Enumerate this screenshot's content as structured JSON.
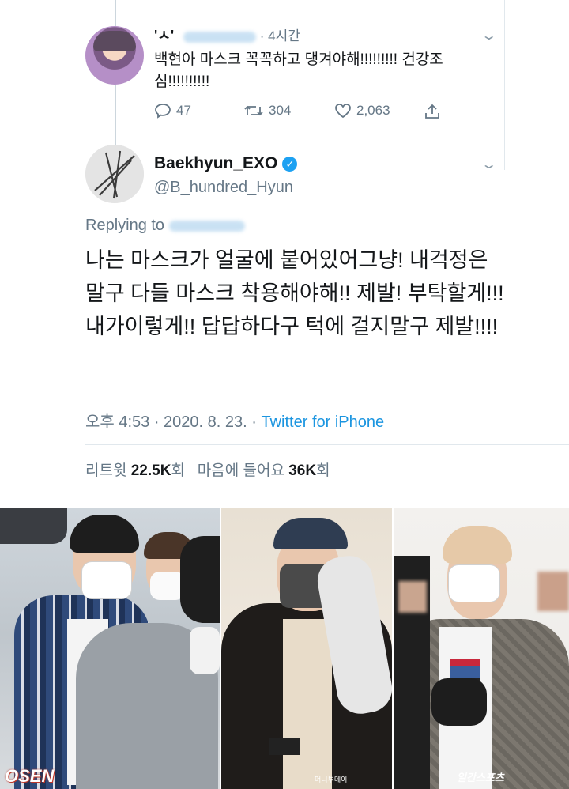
{
  "reply_tweet": {
    "name": "'ㅅ'",
    "meta": "· 4시간",
    "text": "백현아 마스크 꼭꼭하고 댕겨야해!!!!!!!!! 건강조심!!!!!!!!!!",
    "replies": "47",
    "retweets": "304",
    "likes": "2,063"
  },
  "main_tweet": {
    "name": "Baekhyun_EXO",
    "handle": "@B_hundred_Hyun",
    "replying_label": "Replying to",
    "text": "나는 마스크가 얼굴에 붙어있어그냥! 내걱정은 말구 다들 마스크 착용해야해!! 제발! 부탁할게!!! 내가이렇게!! 답답하다구 턱에 걸지말구 제발!!!!",
    "time": "오후 4:53 · 2020. 8. 23. · ",
    "source": "Twitter for iPhone",
    "retweets_label": "리트윗",
    "retweets_count": "22.5K",
    "retweets_suffix": "회",
    "likes_label": "마음에 들어요",
    "likes_count": "36K",
    "likes_suffix": "회"
  },
  "photos": {
    "watermark_left": "OSEN",
    "watermark_mid": "머니투데이",
    "watermark_right": "일간스포츠"
  },
  "colors": {
    "text": "#14171a",
    "secondary": "#657786",
    "link": "#1b95e0",
    "verified": "#1da1f2"
  }
}
